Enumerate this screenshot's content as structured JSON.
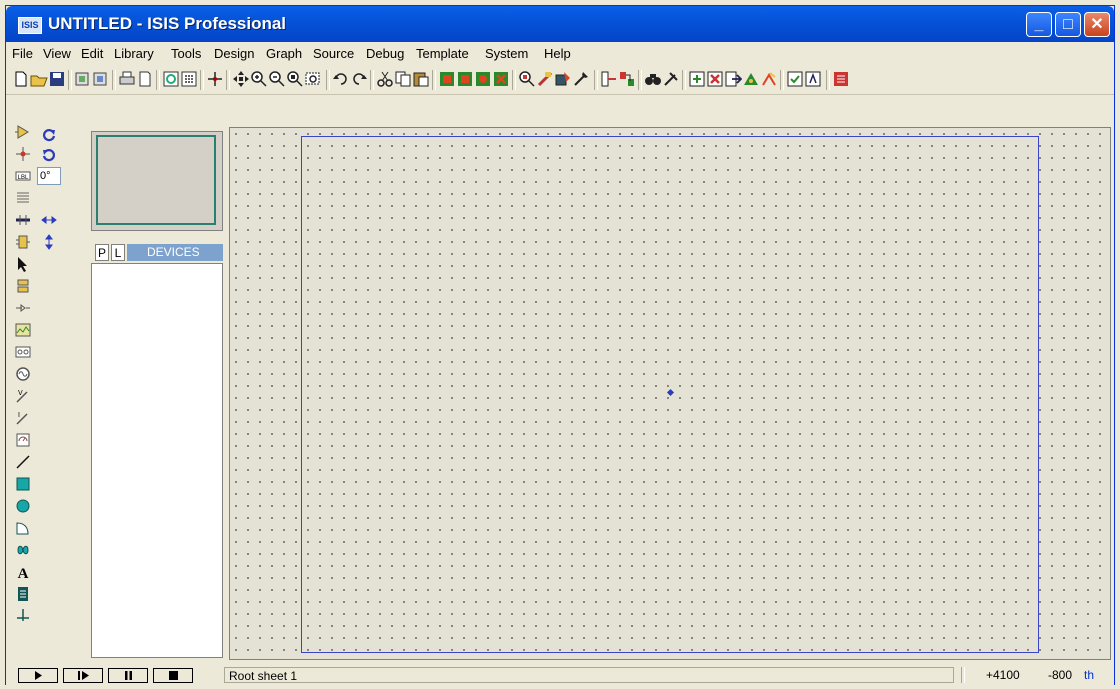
{
  "window": {
    "app_icon_text": "ISIS",
    "title": "UNTITLED - ISIS Professional",
    "buttons": [
      "minimize",
      "maximize",
      "close"
    ]
  },
  "menu": {
    "items": [
      "File",
      "View",
      "Edit",
      "Library",
      "Tools",
      "Design",
      "Graph",
      "Source",
      "Debug",
      "Template",
      "System",
      "Help"
    ]
  },
  "toolbar": {
    "icons": [
      "new-icon",
      "open-icon",
      "save-icon",
      "import-icon",
      "export-icon",
      "print-icon",
      "page-icon",
      "refresh-icon",
      "grid-icon",
      "origin-icon",
      "pan-icon",
      "zoom-in-icon",
      "zoom-out-icon",
      "zoom-all-icon",
      "zoom-area-icon",
      "undo-icon",
      "redo-icon",
      "cut-icon",
      "copy-icon",
      "paste-icon",
      "block-copy-icon",
      "block-move-icon",
      "block-rotate-icon",
      "block-delete-icon",
      "pick-device-icon",
      "make-device-icon",
      "packaging-icon",
      "decompose-icon",
      "wire-autoroute-icon",
      "search-tag-icon",
      "find-icon",
      "property-tool-icon",
      "new-sheet-icon",
      "remove-sheet-icon",
      "exit-to-parent-icon",
      "netlist-icon",
      "bom-icon",
      "erc-icon",
      "ares-icon"
    ]
  },
  "left_tools": {
    "icons": [
      "component-mode-icon",
      "junction-icon",
      "wire-label-icon",
      "text-script-icon",
      "bus-icon",
      "subcircuit-icon",
      "selection-icon",
      "terminal-icon",
      "device-pin-icon",
      "graph-icon",
      "tape-recorder-icon",
      "generator-icon",
      "voltage-probe-icon",
      "current-probe-icon",
      "virtual-instrument-icon",
      "line-icon",
      "box-icon",
      "circle-icon",
      "arc-icon",
      "path-icon",
      "text-icon",
      "symbol-icon",
      "marker-icon"
    ]
  },
  "orientation": {
    "rotation_value": "0°",
    "icons": [
      "rotate-cw-icon",
      "rotate-ccw-icon",
      "mirror-horizontal-icon",
      "mirror-vertical-icon"
    ]
  },
  "selector": {
    "tab_p": "P",
    "tab_l": "L",
    "devices_title": "DEVICES"
  },
  "status": {
    "sheet": "Root sheet 1",
    "x_coord": "+4100",
    "y_coord": "-800",
    "units": "th",
    "play_icons": [
      "play-icon",
      "step-icon",
      "pause-icon",
      "stop-icon"
    ]
  },
  "colors": {
    "title_bar": "#0553d8",
    "workspace": "#e4e2d4",
    "sheet_border": "#3b43c8",
    "devices_header": "#7da2ce"
  }
}
